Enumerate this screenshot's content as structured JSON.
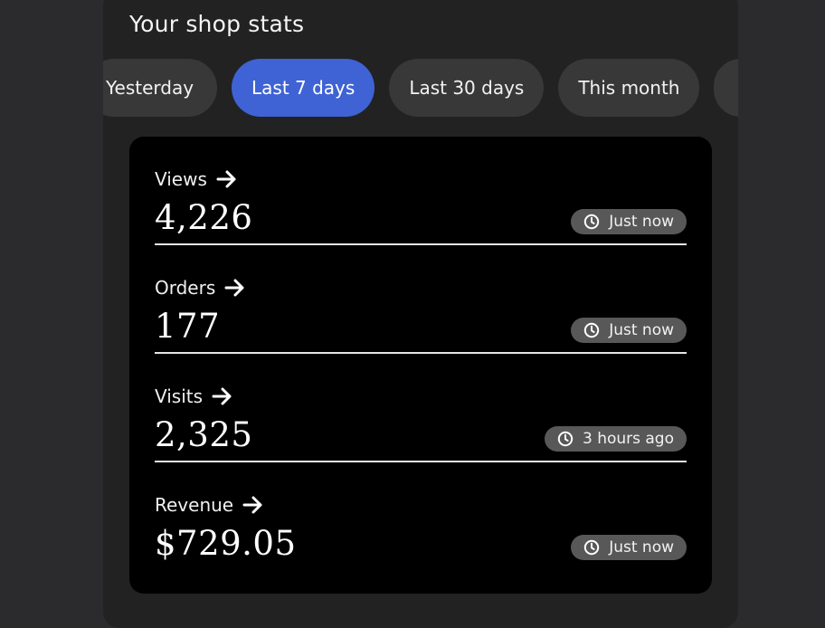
{
  "header": {
    "title": "Your shop stats"
  },
  "range_tabs": [
    {
      "label": "Yesterday",
      "active": false
    },
    {
      "label": "Last 7 days",
      "active": true
    },
    {
      "label": "Last 30 days",
      "active": false
    },
    {
      "label": "This month",
      "active": false
    }
  ],
  "stats": [
    {
      "label": "Views",
      "value": "4,226",
      "updated": "Just now"
    },
    {
      "label": "Orders",
      "value": "177",
      "updated": "Just now"
    },
    {
      "label": "Visits",
      "value": "2,325",
      "updated": "3 hours ago"
    },
    {
      "label": "Revenue",
      "value": "$729.05",
      "updated": "Just now"
    }
  ],
  "icons": {
    "stat_link": "arrow-right-icon",
    "updated": "clock-icon"
  },
  "colors": {
    "active_tab": "#3f63d4",
    "card_bg": "#000000",
    "panel_bg": "#222222",
    "page_bg": "#2b2b2e"
  }
}
